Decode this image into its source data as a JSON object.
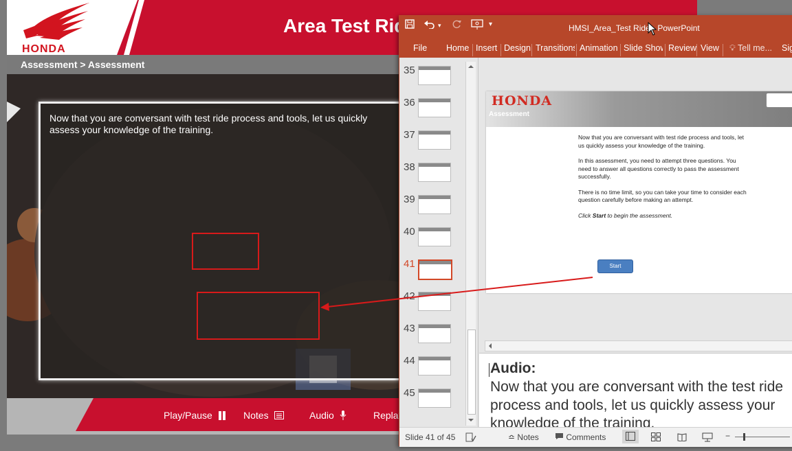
{
  "player": {
    "title": "Area Test Ride",
    "logo_text": "HONDA",
    "breadcrumb": "Assessment > Assessment",
    "stage_text": "Now that you are conversant with test ride process and tools, let us quickly assess your knowledge of the training.",
    "footer": {
      "play_pause": "Play/Pause",
      "notes": "Notes",
      "audio": "Audio",
      "replay": "Replay"
    }
  },
  "ppt": {
    "window_title": "HMSI_Area_Test Ride - PowerPoint",
    "tabs": [
      "File",
      "Home",
      "Insert",
      "Design",
      "Transitions",
      "Animation",
      "Slide Show",
      "Review",
      "View"
    ],
    "tell_me": "Tell me...",
    "sign_in": "Sign in",
    "thumbnails": [
      {
        "num": "35"
      },
      {
        "num": "36"
      },
      {
        "num": "37"
      },
      {
        "num": "38"
      },
      {
        "num": "39"
      },
      {
        "num": "40"
      },
      {
        "num": "41",
        "active": true
      },
      {
        "num": "42"
      },
      {
        "num": "43"
      },
      {
        "num": "44"
      },
      {
        "num": "45"
      }
    ],
    "slide": {
      "logo": "HONDA",
      "header_label": "Assessment",
      "para1": "Now that you are conversant with test ride process and tools, let us quickly assess your knowledge of the training.",
      "para2": "In this assessment, you need to attempt three questions. You need to answer all questions correctly to pass the assessment successfully.",
      "para3": "There is no time limit, so you can take your time to consider each question carefully before making an attempt.",
      "click_prefix": "Click",
      "click_word": "Start",
      "click_suffix": "to begin the assessment.",
      "start_button": "Start"
    },
    "notes": {
      "heading": "Audio:",
      "line1": "Now that you are conversant with the test ride",
      "line2": "process and tools, let us quickly assess your",
      "line3": "knowledge of the training."
    },
    "status": {
      "slide_counter": "Slide 41 of 45",
      "notes": "Notes",
      "comments": "Comments"
    }
  },
  "colors": {
    "honda_red": "#c8102e",
    "ppt_orange": "#b7472a",
    "highlight": "#d81a1a",
    "start_button": "#4a7fc1"
  }
}
